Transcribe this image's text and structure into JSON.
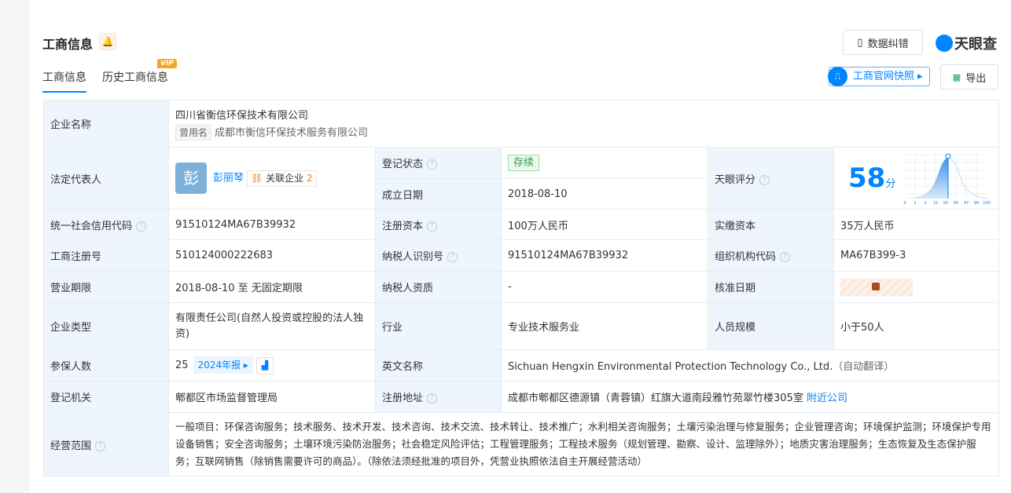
{
  "header": {
    "title": "工商信息",
    "tabs": [
      "工商信息",
      "历史工商信息"
    ],
    "vip": "VIP",
    "correct_btn": "数据纠错",
    "logo": "天眼查",
    "snapshot_btn": "工商官网快照",
    "export_btn": "导出"
  },
  "company": {
    "name_label": "企业名称",
    "name": "四川省衡信环保技术有限公司",
    "former_tag": "曾用名",
    "former_name": "成都市衡信环保技术服务有限公司",
    "rep_label": "法定代表人",
    "rep_avatar": "彭",
    "rep_name": "彭丽琴",
    "rel_label": "关联企业",
    "rel_count": "2",
    "status_label": "登记状态",
    "status": "存续",
    "found_label": "成立日期",
    "found": "2018-08-10",
    "score_label": "天眼评分",
    "score": "58",
    "score_unit": "分",
    "credit_label": "统一社会信用代码",
    "credit": "91510124MA67B39932",
    "capital_label": "注册资本",
    "capital": "100万人民币",
    "paid_label": "实缴资本",
    "paid": "35万人民币",
    "reg_no_label": "工商注册号",
    "reg_no": "510124000222683",
    "tax_label": "纳税人识别号",
    "tax": "91510124MA67B39932",
    "org_label": "组织机构代码",
    "org": "MA67B399-3",
    "term_label": "营业期限",
    "term": "2018-08-10 至 无固定期限",
    "taxq_label": "纳税人资质",
    "taxq": "-",
    "approve_label": "核准日期",
    "type_label": "企业类型",
    "type": "有限责任公司(自然人投资或控股的法人独资)",
    "industry_label": "行业",
    "industry": "专业技术服务业",
    "staff_label": "人员规模",
    "staff": "小于50人",
    "insured_label": "参保人数",
    "insured": "25",
    "report": "2024年报",
    "en_label": "英文名称",
    "en": "Sichuan Hengxin Environmental Protection Technology Co., Ltd.",
    "en_auto": "（自动翻译）",
    "authority_label": "登记机关",
    "authority": "郫都区市场监督管理局",
    "addr_label": "注册地址",
    "addr": "成都市郫都区德源镇（青蓉镇）红旗大道南段雅竹苑翠竹楼305室",
    "nearby": "附近公司",
    "scope_label": "经营范围",
    "scope": "一般项目：环保咨询服务；技术服务、技术开发、技术咨询、技术交流、技术转让、技术推广；水利相关咨询服务；土壤污染治理与修复服务；企业管理咨询；环境保护监测；环境保护专用设备销售；安全咨询服务；土壤环境污染防治服务；社会稳定风险评估；工程管理服务；工程技术服务（规划管理、勘察、设计、监理除外）；地质灾害治理服务；生态恢复及生态保护服务；互联网销售（除销售需要许可的商品）。（除依法须经批准的项目外，凭营业执照依法自主开展经营活动）"
  },
  "score_axis": [
    "0",
    "1",
    "3",
    "15",
    "50",
    "85",
    "97",
    "99",
    "100"
  ]
}
